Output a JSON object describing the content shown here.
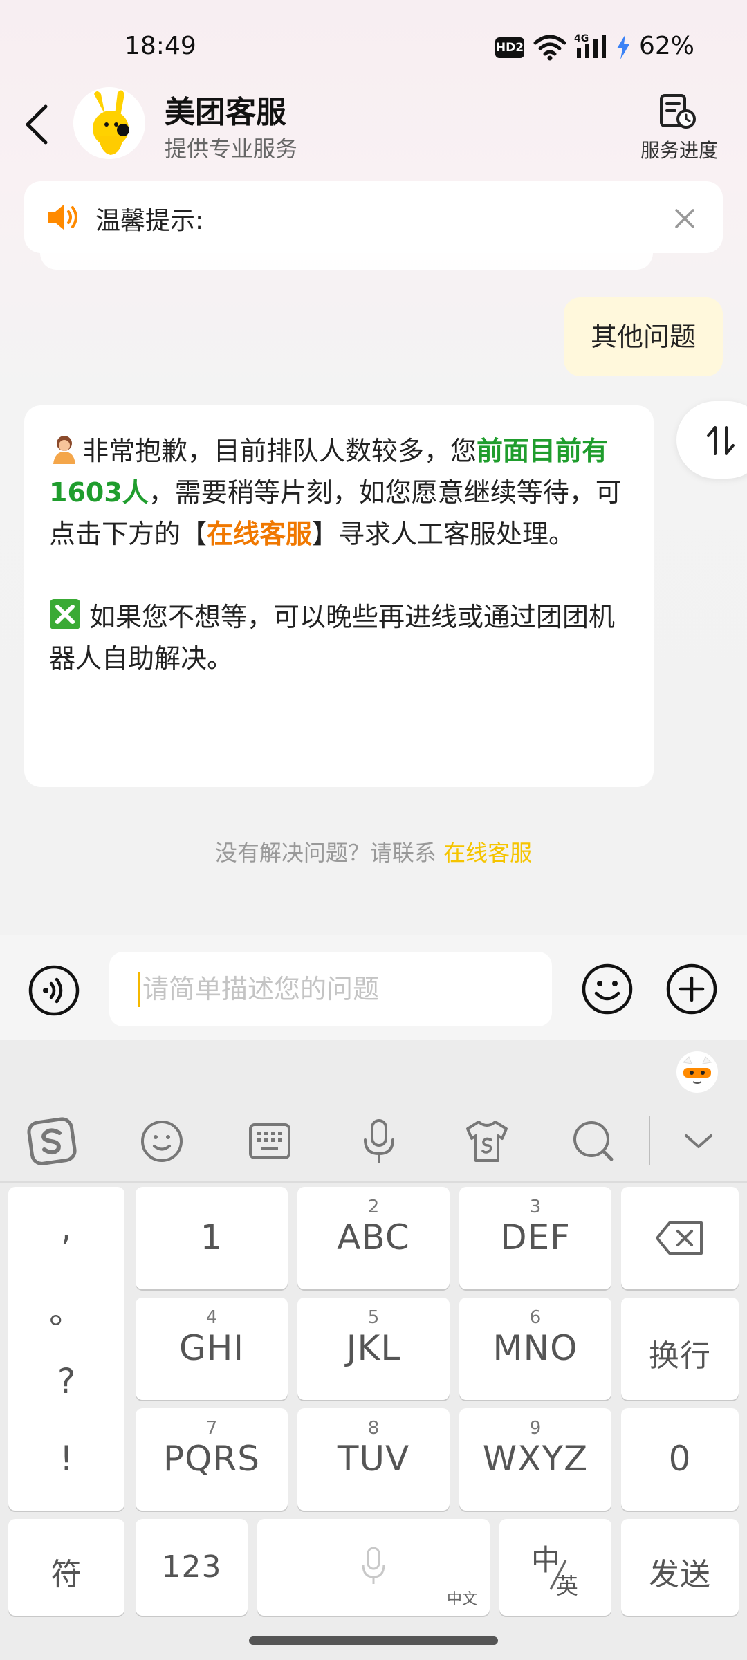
{
  "status_bar": {
    "time": "18:49",
    "hd_badge": "HD2",
    "network": "4G",
    "battery": "62%"
  },
  "header": {
    "title": "美团客服",
    "subtitle": "提供专业服务",
    "progress_label": "服务进度"
  },
  "notice": {
    "label": "温馨提示:"
  },
  "messages": {
    "user": "其他问题",
    "agent": {
      "p1_part1": "非常抱歉，目前排队人数较多，您",
      "p1_highlight": "前面目前有1603人",
      "p1_part2": "，需要稍等片刻，如您愿意继续等待，可点击下方的【",
      "p1_link": "在线客服",
      "p1_part3": "】寻求人工客服处理。",
      "p2": "如果您不想等，可以晚些再进线或通过团团机器人自助解决。"
    }
  },
  "contact": {
    "prompt": "没有解决问题？请联系 ",
    "link": "在线客服"
  },
  "input": {
    "placeholder": "请简单描述您的问题",
    "value": ""
  },
  "keyboard": {
    "punctuation": [
      ",",
      "。",
      "?",
      "!"
    ],
    "keys": [
      {
        "num": "",
        "label": "1"
      },
      {
        "num": "2",
        "label": "ABC"
      },
      {
        "num": "3",
        "label": "DEF"
      },
      {
        "num": "4",
        "label": "GHI"
      },
      {
        "num": "5",
        "label": "JKL"
      },
      {
        "num": "6",
        "label": "MNO"
      },
      {
        "num": "7",
        "label": "PQRS"
      },
      {
        "num": "8",
        "label": "TUV"
      },
      {
        "num": "9",
        "label": "WXYZ"
      }
    ],
    "newline": "换行",
    "zero": "0",
    "symbols": "符",
    "numbers": "123",
    "space_hint": "中文",
    "lang_main": "中",
    "lang_sub": "英",
    "send": "发送"
  },
  "colors": {
    "accent_green": "#1f9d2d",
    "accent_orange": "#f07800",
    "link_yellow": "#f5c400",
    "user_bubble": "#fff8dc"
  }
}
